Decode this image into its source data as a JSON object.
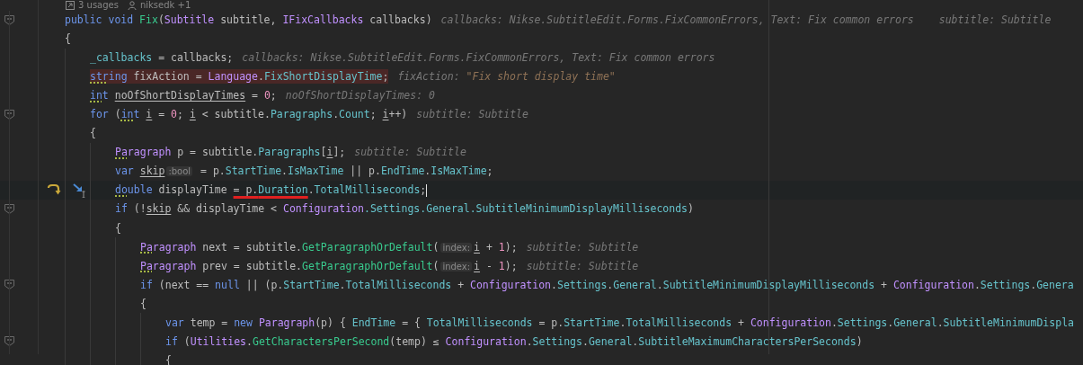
{
  "code_vision": [
    {
      "kind": "usages",
      "text": "3 usages"
    },
    {
      "kind": "author",
      "text": "niksedk +1"
    }
  ],
  "lines": [
    {
      "current": false,
      "error": false,
      "fold": true,
      "tokens": [
        {
          "text": "public ",
          "kind": "kw"
        },
        {
          "text": "void ",
          "kind": "kw"
        },
        {
          "text": "Fix",
          "kind": "method"
        },
        {
          "text": "(",
          "kind": "plain"
        },
        {
          "text": "Subtitle",
          "kind": "type"
        },
        {
          "text": " subtitle, ",
          "kind": "plain"
        },
        {
          "text": "IFixCallbacks",
          "kind": "type"
        },
        {
          "text": " callbacks)",
          "kind": "plain"
        },
        {
          "text": "callbacks: Nikse.SubtitleEdit.Forms.FixCommonErrors, Text: Fix common errors",
          "kind": "hint"
        },
        {
          "text": "subtitle: Subtitle",
          "kind": "hint_far"
        }
      ]
    },
    {
      "current": false,
      "error": false,
      "fold": false,
      "tokens": [
        {
          "text": "{",
          "kind": "plain"
        }
      ],
      "children": [
        {
          "current": false,
          "error": false,
          "fold": false,
          "tokens": [
            {
              "text": "_callbacks",
              "kind": "field"
            },
            {
              "text": " = callbacks;",
              "kind": "plain"
            },
            {
              "text": "callbacks: Nikse.SubtitleEdit.Forms.FixCommonErrors, Text: Fix common errors",
              "kind": "hint"
            }
          ]
        },
        {
          "current": false,
          "error": true,
          "fold": false,
          "tokens": [
            {
              "text": "str",
              "kind": "kw",
              "dotted": true
            },
            {
              "text": "ing",
              "kind": "kw"
            },
            {
              "text": " fixAction = ",
              "kind": "plain"
            },
            {
              "text": "Language",
              "kind": "type"
            },
            {
              "text": ".",
              "kind": "plain"
            },
            {
              "text": "FixShortDisplayTime",
              "kind": "field"
            },
            {
              "text": ";",
              "kind": "plain"
            },
            {
              "text": "fixAction:",
              "kind": "hint"
            },
            {
              "text": " \"Fix short display time\"",
              "kind": "hint_str"
            }
          ]
        },
        {
          "current": false,
          "error": false,
          "fold": false,
          "tokens": [
            {
              "text": "in",
              "kind": "kw",
              "dotted": true
            },
            {
              "text": "t ",
              "kind": "kw"
            },
            {
              "text": "noOfShortDisplayTimes",
              "kind": "plain",
              "underlined": true
            },
            {
              "text": " = ",
              "kind": "plain"
            },
            {
              "text": "0",
              "kind": "num"
            },
            {
              "text": ";",
              "kind": "plain"
            },
            {
              "text": "noOfShortDisplayTimes: 0",
              "kind": "hint"
            }
          ]
        },
        {
          "current": false,
          "error": false,
          "fold": true,
          "tokens": [
            {
              "text": "for",
              "kind": "kw"
            },
            {
              "text": " (",
              "kind": "plain"
            },
            {
              "text": "in",
              "kind": "kw",
              "dotted": true
            },
            {
              "text": "t ",
              "kind": "kw"
            },
            {
              "text": "i",
              "kind": "plain",
              "underlined": true
            },
            {
              "text": " = ",
              "kind": "plain"
            },
            {
              "text": "0",
              "kind": "num"
            },
            {
              "text": "; ",
              "kind": "plain"
            },
            {
              "text": "i",
              "kind": "plain",
              "underlined": true
            },
            {
              "text": " < subtitle.",
              "kind": "plain"
            },
            {
              "text": "Paragraphs",
              "kind": "field"
            },
            {
              "text": ".",
              "kind": "plain"
            },
            {
              "text": "Count",
              "kind": "field"
            },
            {
              "text": "; ",
              "kind": "plain"
            },
            {
              "text": "i",
              "kind": "plain",
              "underlined": true
            },
            {
              "text": "++)",
              "kind": "plain"
            },
            {
              "text": "subtitle: Subtitle",
              "kind": "hint"
            }
          ]
        },
        {
          "current": false,
          "error": false,
          "fold": false,
          "tokens": [
            {
              "text": "{",
              "kind": "plain"
            }
          ],
          "children": [
            {
              "current": false,
              "error": false,
              "fold": false,
              "tokens": [
                {
                  "text": "Pa",
                  "kind": "type",
                  "dotted": true
                },
                {
                  "text": "ragraph",
                  "kind": "type"
                },
                {
                  "text": " p = subtitle.",
                  "kind": "plain"
                },
                {
                  "text": "Paragraphs",
                  "kind": "field"
                },
                {
                  "text": "[",
                  "kind": "plain"
                },
                {
                  "text": "i",
                  "kind": "plain",
                  "underlined": true
                },
                {
                  "text": "];",
                  "kind": "plain"
                },
                {
                  "text": "subtitle: Subtitle",
                  "kind": "hint"
                }
              ]
            },
            {
              "current": false,
              "error": false,
              "fold": false,
              "tokens": [
                {
                  "text": "var ",
                  "kind": "kw"
                },
                {
                  "text": "skip",
                  "kind": "plain",
                  "underlined": true
                },
                {
                  "text": ":bool",
                  "kind": "inlay"
                },
                {
                  "text": " = p.",
                  "kind": "plain"
                },
                {
                  "text": "StartTime",
                  "kind": "field"
                },
                {
                  "text": ".",
                  "kind": "plain"
                },
                {
                  "text": "IsMaxTime",
                  "kind": "field"
                },
                {
                  "text": " || p.",
                  "kind": "plain"
                },
                {
                  "text": "EndTime",
                  "kind": "field"
                },
                {
                  "text": ".",
                  "kind": "plain"
                },
                {
                  "text": "IsMaxTime",
                  "kind": "field"
                },
                {
                  "text": ";",
                  "kind": "plain"
                }
              ]
            },
            {
              "current": true,
              "error": false,
              "fold": false,
              "tokens": [
                {
                  "text": "do",
                  "kind": "kw",
                  "dotted": true
                },
                {
                  "text": "uble",
                  "kind": "kw"
                },
                {
                  "text": " displayTime ",
                  "kind": "plain"
                },
                {
                  "text": "= p.",
                  "kind": "plain",
                  "marked": true
                },
                {
                  "text": "Duration",
                  "kind": "field",
                  "marked": true
                },
                {
                  "text": ".",
                  "kind": "plain"
                },
                {
                  "text": "TotalMilliseconds",
                  "kind": "field"
                },
                {
                  "text": ";",
                  "kind": "plain"
                }
              ]
            },
            {
              "current": false,
              "error": false,
              "fold": true,
              "tokens": [
                {
                  "text": "if",
                  "kind": "kw"
                },
                {
                  "text": " (!",
                  "kind": "plain"
                },
                {
                  "text": "skip",
                  "kind": "plain",
                  "underlined": true
                },
                {
                  "text": " && displayTime < ",
                  "kind": "plain"
                },
                {
                  "text": "Configuration",
                  "kind": "type"
                },
                {
                  "text": ".Settings.General.SubtitleMinimumDisplayMilliseconds",
                  "kind": "field"
                },
                {
                  "text": ")",
                  "kind": "plain"
                }
              ]
            },
            {
              "current": false,
              "error": false,
              "fold": false,
              "tokens": [
                {
                  "text": "{",
                  "kind": "plain"
                }
              ],
              "children": [
                {
                  "current": false,
                  "error": false,
                  "fold": false,
                  "tokens": [
                    {
                      "text": "Pa",
                      "kind": "type",
                      "dotted": true
                    },
                    {
                      "text": "ragraph",
                      "kind": "type"
                    },
                    {
                      "text": " next = subtitle.",
                      "kind": "plain"
                    },
                    {
                      "text": "GetParagraphOrDefault",
                      "kind": "method"
                    },
                    {
                      "text": "(",
                      "kind": "plain"
                    },
                    {
                      "text": "index:",
                      "kind": "inlay"
                    },
                    {
                      "text": "i",
                      "kind": "plain",
                      "underlined": true
                    },
                    {
                      "text": " + ",
                      "kind": "plain"
                    },
                    {
                      "text": "1",
                      "kind": "num"
                    },
                    {
                      "text": ");",
                      "kind": "plain"
                    },
                    {
                      "text": "subtitle: Subtitle",
                      "kind": "hint"
                    }
                  ]
                },
                {
                  "current": false,
                  "error": false,
                  "fold": false,
                  "tokens": [
                    {
                      "text": "Pa",
                      "kind": "type",
                      "dotted": true
                    },
                    {
                      "text": "ragraph",
                      "kind": "type"
                    },
                    {
                      "text": " prev = subtitle.",
                      "kind": "plain"
                    },
                    {
                      "text": "GetParagraphOrDefault",
                      "kind": "method"
                    },
                    {
                      "text": "(",
                      "kind": "plain"
                    },
                    {
                      "text": "index:",
                      "kind": "inlay"
                    },
                    {
                      "text": "i",
                      "kind": "plain",
                      "underlined": true
                    },
                    {
                      "text": " - ",
                      "kind": "plain"
                    },
                    {
                      "text": "1",
                      "kind": "num"
                    },
                    {
                      "text": ");",
                      "kind": "plain"
                    },
                    {
                      "text": "subtitle: Subtitle",
                      "kind": "hint"
                    }
                  ]
                },
                {
                  "current": false,
                  "error": false,
                  "fold": true,
                  "tokens": [
                    {
                      "text": "if",
                      "kind": "kw"
                    },
                    {
                      "text": " (next == ",
                      "kind": "plain"
                    },
                    {
                      "text": "null",
                      "kind": "kw"
                    },
                    {
                      "text": " || (p.",
                      "kind": "plain"
                    },
                    {
                      "text": "StartTime",
                      "kind": "field"
                    },
                    {
                      "text": ".",
                      "kind": "plain"
                    },
                    {
                      "text": "TotalMilliseconds",
                      "kind": "field"
                    },
                    {
                      "text": " + ",
                      "kind": "plain"
                    },
                    {
                      "text": "Configuration",
                      "kind": "type"
                    },
                    {
                      "text": ".",
                      "kind": "plain"
                    },
                    {
                      "text": "Settings",
                      "kind": "field"
                    },
                    {
                      "text": ".",
                      "kind": "plain"
                    },
                    {
                      "text": "General",
                      "kind": "field"
                    },
                    {
                      "text": ".",
                      "kind": "plain"
                    },
                    {
                      "text": "SubtitleMinimumDisplayMilliseconds",
                      "kind": "field"
                    },
                    {
                      "text": " + ",
                      "kind": "plain"
                    },
                    {
                      "text": "Configuration",
                      "kind": "type"
                    },
                    {
                      "text": ".",
                      "kind": "plain"
                    },
                    {
                      "text": "Settings",
                      "kind": "field"
                    },
                    {
                      "text": ".",
                      "kind": "plain"
                    },
                    {
                      "text": "Genera",
                      "kind": "field"
                    }
                  ]
                },
                {
                  "current": false,
                  "error": false,
                  "fold": false,
                  "tokens": [
                    {
                      "text": "{",
                      "kind": "plain"
                    }
                  ],
                  "children": [
                    {
                      "current": false,
                      "error": false,
                      "fold": false,
                      "tokens": [
                        {
                          "text": "var",
                          "kind": "kw"
                        },
                        {
                          "text": " temp = ",
                          "kind": "plain"
                        },
                        {
                          "text": "new ",
                          "kind": "kw"
                        },
                        {
                          "text": "Paragraph",
                          "kind": "type"
                        },
                        {
                          "text": "(p) { ",
                          "kind": "plain"
                        },
                        {
                          "text": "EndTime",
                          "kind": "field"
                        },
                        {
                          "text": " = { ",
                          "kind": "plain"
                        },
                        {
                          "text": "TotalMilliseconds",
                          "kind": "field"
                        },
                        {
                          "text": " = p.",
                          "kind": "plain"
                        },
                        {
                          "text": "StartTime",
                          "kind": "field"
                        },
                        {
                          "text": ".",
                          "kind": "plain"
                        },
                        {
                          "text": "TotalMilliseconds",
                          "kind": "field"
                        },
                        {
                          "text": " + ",
                          "kind": "plain"
                        },
                        {
                          "text": "Configuration",
                          "kind": "type"
                        },
                        {
                          "text": ".",
                          "kind": "plain"
                        },
                        {
                          "text": "Settings",
                          "kind": "field"
                        },
                        {
                          "text": ".",
                          "kind": "plain"
                        },
                        {
                          "text": "General",
                          "kind": "field"
                        },
                        {
                          "text": ".",
                          "kind": "plain"
                        },
                        {
                          "text": "SubtitleMinimumDispla",
                          "kind": "field"
                        }
                      ]
                    },
                    {
                      "current": false,
                      "error": false,
                      "fold": true,
                      "tokens": [
                        {
                          "text": "if",
                          "kind": "kw"
                        },
                        {
                          "text": " (",
                          "kind": "plain"
                        },
                        {
                          "text": "Utilities",
                          "kind": "type"
                        },
                        {
                          "text": ".",
                          "kind": "plain"
                        },
                        {
                          "text": "GetCharactersPerSecond",
                          "kind": "method"
                        },
                        {
                          "text": "(temp) ≤ ",
                          "kind": "plain"
                        },
                        {
                          "text": "Configuration",
                          "kind": "type"
                        },
                        {
                          "text": ".",
                          "kind": "plain"
                        },
                        {
                          "text": "Settings",
                          "kind": "field"
                        },
                        {
                          "text": ".",
                          "kind": "plain"
                        },
                        {
                          "text": "General",
                          "kind": "field"
                        },
                        {
                          "text": ".",
                          "kind": "plain"
                        },
                        {
                          "text": "SubtitleMaximumCharactersPerSeconds",
                          "kind": "field"
                        },
                        {
                          "text": ")",
                          "kind": "plain"
                        }
                      ]
                    },
                    {
                      "current": false,
                      "error": false,
                      "fold": false,
                      "tokens": [
                        {
                          "text": "{",
                          "kind": "plain"
                        }
                      ]
                    }
                  ]
                }
              ]
            }
          ]
        }
      ]
    }
  ]
}
